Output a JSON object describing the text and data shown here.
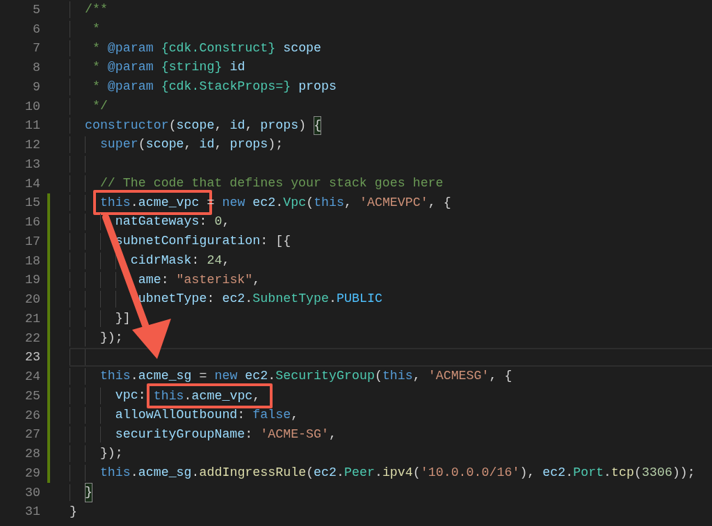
{
  "editor": {
    "lines": [
      {
        "number": "5",
        "modified": false,
        "current": false,
        "guides": [
          {
            "kind": "indent"
          }
        ],
        "tokens": [
          {
            "text": "/**",
            "kind": "comment"
          }
        ]
      },
      {
        "number": "6",
        "modified": false,
        "current": false,
        "guides": [
          {
            "kind": "indent"
          }
        ],
        "tokens": [
          {
            "text": " *",
            "kind": "comment"
          }
        ]
      },
      {
        "number": "7",
        "modified": false,
        "current": false,
        "guides": [
          {
            "kind": "indent"
          }
        ],
        "tokens": [
          {
            "text": " * ",
            "kind": "comment"
          },
          {
            "text": "@param",
            "kind": "doctag"
          },
          {
            "text": " {cdk.Construct}",
            "kind": "doctype"
          },
          {
            "text": " scope",
            "kind": "var"
          }
        ]
      },
      {
        "number": "8",
        "modified": false,
        "current": false,
        "guides": [
          {
            "kind": "indent"
          }
        ],
        "tokens": [
          {
            "text": " * ",
            "kind": "comment"
          },
          {
            "text": "@param",
            "kind": "doctag"
          },
          {
            "text": " {string}",
            "kind": "doctype"
          },
          {
            "text": " id",
            "kind": "var"
          }
        ]
      },
      {
        "number": "9",
        "modified": false,
        "current": false,
        "guides": [
          {
            "kind": "indent"
          }
        ],
        "tokens": [
          {
            "text": " * ",
            "kind": "comment"
          },
          {
            "text": "@param",
            "kind": "doctag"
          },
          {
            "text": " {cdk.StackProps=}",
            "kind": "doctype"
          },
          {
            "text": " props",
            "kind": "var"
          }
        ]
      },
      {
        "number": "10",
        "modified": false,
        "current": false,
        "guides": [
          {
            "kind": "indent"
          }
        ],
        "tokens": [
          {
            "text": " */",
            "kind": "comment"
          }
        ]
      },
      {
        "number": "11",
        "modified": false,
        "current": false,
        "guides": [
          {
            "kind": "indent"
          }
        ],
        "tokens": [
          {
            "text": "constructor",
            "kind": "keyword"
          },
          {
            "text": "(",
            "kind": "punct"
          },
          {
            "text": "scope",
            "kind": "var"
          },
          {
            "text": ", ",
            "kind": "punct"
          },
          {
            "text": "id",
            "kind": "var"
          },
          {
            "text": ", ",
            "kind": "punct"
          },
          {
            "text": "props",
            "kind": "var"
          },
          {
            "text": ") ",
            "kind": "punct"
          },
          {
            "text": "{",
            "kind": "bracket"
          }
        ]
      },
      {
        "number": "12",
        "modified": false,
        "current": false,
        "guides": [
          {
            "kind": "indent"
          },
          {
            "kind": "indent"
          }
        ],
        "tokens": [
          {
            "text": "super",
            "kind": "keyword"
          },
          {
            "text": "(",
            "kind": "punct"
          },
          {
            "text": "scope",
            "kind": "var"
          },
          {
            "text": ", ",
            "kind": "punct"
          },
          {
            "text": "id",
            "kind": "var"
          },
          {
            "text": ", ",
            "kind": "punct"
          },
          {
            "text": "props",
            "kind": "var"
          },
          {
            "text": ");",
            "kind": "punct"
          }
        ]
      },
      {
        "number": "13",
        "modified": false,
        "current": false,
        "guides": [
          {
            "kind": "indent"
          },
          {
            "kind": "indent"
          }
        ]
      },
      {
        "number": "14",
        "modified": false,
        "current": false,
        "guides": [
          {
            "kind": "indent"
          },
          {
            "kind": "indent"
          }
        ],
        "tokens": [
          {
            "text": "// The code that defines your stack goes here",
            "kind": "comment"
          }
        ]
      },
      {
        "number": "15",
        "modified": true,
        "current": false,
        "guides": [
          {
            "kind": "indent"
          },
          {
            "kind": "indent"
          }
        ],
        "tokens": [
          {
            "kind": "callout",
            "children": [
              {
                "text": "this",
                "kind": "keyword"
              },
              {
                "text": ".",
                "kind": "punct"
              },
              {
                "text": "acme_vpc",
                "kind": "var"
              }
            ]
          },
          {
            "text": " = ",
            "kind": "punct"
          },
          {
            "text": "new",
            "kind": "keyword"
          },
          {
            "text": " ec2",
            "kind": "var"
          },
          {
            "text": ".",
            "kind": "punct"
          },
          {
            "text": "Vpc",
            "kind": "class"
          },
          {
            "text": "(",
            "kind": "punct"
          },
          {
            "text": "this",
            "kind": "keyword"
          },
          {
            "text": ", ",
            "kind": "punct"
          },
          {
            "text": "'ACMEVPC'",
            "kind": "string"
          },
          {
            "text": ", {",
            "kind": "punct"
          }
        ]
      },
      {
        "number": "16",
        "modified": true,
        "current": false,
        "guides": [
          {
            "kind": "indent"
          },
          {
            "kind": "indent"
          },
          {
            "kind": "indent"
          }
        ],
        "tokens": [
          {
            "text": "natGateways",
            "kind": "var"
          },
          {
            "text": ": ",
            "kind": "punct"
          },
          {
            "text": "0",
            "kind": "number"
          },
          {
            "text": ",",
            "kind": "punct"
          }
        ]
      },
      {
        "number": "17",
        "modified": true,
        "current": false,
        "guides": [
          {
            "kind": "indent"
          },
          {
            "kind": "indent"
          },
          {
            "kind": "indent"
          }
        ],
        "tokens": [
          {
            "text": "subnetConfiguration",
            "kind": "var"
          },
          {
            "text": ": [{",
            "kind": "punct"
          }
        ]
      },
      {
        "number": "18",
        "modified": true,
        "current": false,
        "guides": [
          {
            "kind": "indent"
          },
          {
            "kind": "indent"
          },
          {
            "kind": "indent"
          },
          {
            "kind": "indent"
          }
        ],
        "tokens": [
          {
            "text": "cidrMask",
            "kind": "var"
          },
          {
            "text": ": ",
            "kind": "punct"
          },
          {
            "text": "24",
            "kind": "number"
          },
          {
            "text": ",",
            "kind": "punct"
          }
        ]
      },
      {
        "number": "19",
        "modified": true,
        "current": false,
        "guides": [
          {
            "kind": "indent"
          },
          {
            "kind": "indent"
          },
          {
            "kind": "indent"
          },
          {
            "kind": "indent"
          }
        ],
        "tokens": [
          {
            "text": " ame",
            "kind": "var"
          },
          {
            "text": ": ",
            "kind": "punct"
          },
          {
            "text": "\"asterisk\"",
            "kind": "string"
          },
          {
            "text": ",",
            "kind": "punct"
          }
        ]
      },
      {
        "number": "20",
        "modified": true,
        "current": false,
        "guides": [
          {
            "kind": "indent"
          },
          {
            "kind": "indent"
          },
          {
            "kind": "indent"
          },
          {
            "kind": "indent"
          }
        ],
        "tokens": [
          {
            "text": " ubnetType",
            "kind": "var"
          },
          {
            "text": ": ",
            "kind": "punct"
          },
          {
            "text": "ec2",
            "kind": "var"
          },
          {
            "text": ".",
            "kind": "punct"
          },
          {
            "text": "SubnetType",
            "kind": "class"
          },
          {
            "text": ".",
            "kind": "punct"
          },
          {
            "text": "PUBLIC",
            "kind": "constant"
          }
        ]
      },
      {
        "number": "21",
        "modified": true,
        "current": false,
        "guides": [
          {
            "kind": "indent"
          },
          {
            "kind": "indent"
          },
          {
            "kind": "indent"
          }
        ],
        "tokens": [
          {
            "text": "}]",
            "kind": "punct"
          }
        ]
      },
      {
        "number": "22",
        "modified": true,
        "current": false,
        "guides": [
          {
            "kind": "indent"
          },
          {
            "kind": "indent"
          }
        ],
        "tokens": [
          {
            "text": "});",
            "kind": "punct"
          }
        ]
      },
      {
        "number": "23",
        "modified": true,
        "current": true,
        "guides": [
          {
            "kind": "indent"
          },
          {
            "kind": "indent"
          }
        ]
      },
      {
        "number": "24",
        "modified": true,
        "current": false,
        "guides": [
          {
            "kind": "indent"
          },
          {
            "kind": "indent"
          }
        ],
        "tokens": [
          {
            "text": "this",
            "kind": "keyword"
          },
          {
            "text": ".",
            "kind": "punct"
          },
          {
            "text": "acme_sg",
            "kind": "var"
          },
          {
            "text": " = ",
            "kind": "punct"
          },
          {
            "text": "new",
            "kind": "keyword"
          },
          {
            "text": " ec2",
            "kind": "var"
          },
          {
            "text": ".",
            "kind": "punct"
          },
          {
            "text": "SecurityGroup",
            "kind": "class"
          },
          {
            "text": "(",
            "kind": "punct"
          },
          {
            "text": "this",
            "kind": "keyword"
          },
          {
            "text": ", ",
            "kind": "punct"
          },
          {
            "text": "'ACMESG'",
            "kind": "string"
          },
          {
            "text": ", {",
            "kind": "punct"
          }
        ]
      },
      {
        "number": "25",
        "modified": true,
        "current": false,
        "guides": [
          {
            "kind": "indent"
          },
          {
            "kind": "indent"
          },
          {
            "kind": "indent"
          }
        ],
        "tokens": [
          {
            "text": "vpc",
            "kind": "var"
          },
          {
            "text": ": ",
            "kind": "punct"
          },
          {
            "kind": "callout",
            "children": [
              {
                "text": "this",
                "kind": "keyword"
              },
              {
                "text": ".",
                "kind": "punct"
              },
              {
                "text": "acme_vpc",
                "kind": "var"
              },
              {
                "text": ",",
                "kind": "punct"
              }
            ]
          }
        ]
      },
      {
        "number": "26",
        "modified": true,
        "current": false,
        "guides": [
          {
            "kind": "indent"
          },
          {
            "kind": "indent"
          },
          {
            "kind": "indent"
          }
        ],
        "tokens": [
          {
            "text": "allowAllOutbound",
            "kind": "var"
          },
          {
            "text": ": ",
            "kind": "punct"
          },
          {
            "text": "false",
            "kind": "keyword"
          },
          {
            "text": ",",
            "kind": "punct"
          }
        ]
      },
      {
        "number": "27",
        "modified": true,
        "current": false,
        "guides": [
          {
            "kind": "indent"
          },
          {
            "kind": "indent"
          },
          {
            "kind": "indent"
          }
        ],
        "tokens": [
          {
            "text": "securityGroupName",
            "kind": "var"
          },
          {
            "text": ": ",
            "kind": "punct"
          },
          {
            "text": "'ACME-SG'",
            "kind": "string"
          },
          {
            "text": ",",
            "kind": "punct"
          }
        ]
      },
      {
        "number": "28",
        "modified": true,
        "current": false,
        "guides": [
          {
            "kind": "indent"
          },
          {
            "kind": "indent"
          }
        ],
        "tokens": [
          {
            "text": "});",
            "kind": "punct"
          }
        ]
      },
      {
        "number": "29",
        "modified": true,
        "current": false,
        "guides": [
          {
            "kind": "indent"
          },
          {
            "kind": "indent"
          }
        ],
        "tokens": [
          {
            "text": "this",
            "kind": "keyword"
          },
          {
            "text": ".",
            "kind": "punct"
          },
          {
            "text": "acme_sg",
            "kind": "var"
          },
          {
            "text": ".",
            "kind": "punct"
          },
          {
            "text": "addIngressRule",
            "kind": "function"
          },
          {
            "text": "(",
            "kind": "punct"
          },
          {
            "text": "ec2",
            "kind": "var"
          },
          {
            "text": ".",
            "kind": "punct"
          },
          {
            "text": "Peer",
            "kind": "class"
          },
          {
            "text": ".",
            "kind": "punct"
          },
          {
            "text": "ipv4",
            "kind": "function"
          },
          {
            "text": "(",
            "kind": "punct"
          },
          {
            "text": "'10.0.0.0/16'",
            "kind": "string"
          },
          {
            "text": "), ",
            "kind": "punct"
          },
          {
            "text": "ec2",
            "kind": "var"
          },
          {
            "text": ".",
            "kind": "punct"
          },
          {
            "text": "Port",
            "kind": "class"
          },
          {
            "text": ".",
            "kind": "punct"
          },
          {
            "text": "tcp",
            "kind": "function"
          },
          {
            "text": "(",
            "kind": "punct"
          },
          {
            "text": "3306",
            "kind": "number"
          },
          {
            "text": "));",
            "kind": "punct"
          }
        ]
      },
      {
        "number": "30",
        "modified": false,
        "current": false,
        "guides": [
          {
            "kind": "indent"
          }
        ],
        "tokens": [
          {
            "text": "}",
            "kind": "bracket"
          }
        ]
      },
      {
        "number": "31",
        "modified": false,
        "current": false,
        "tokens": [
          {
            "text": "}",
            "kind": "punct"
          }
        ]
      }
    ]
  }
}
